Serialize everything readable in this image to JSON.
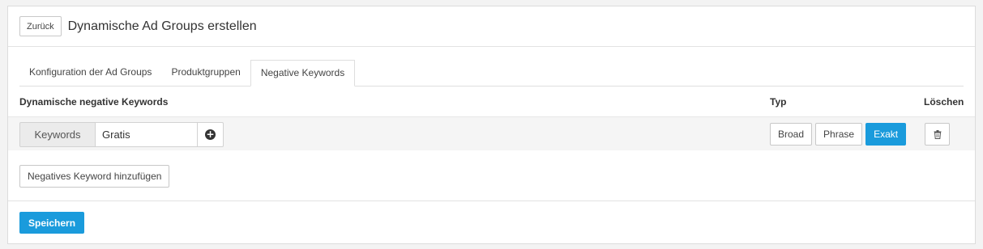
{
  "header": {
    "back_label": "Zurück",
    "title": "Dynamische Ad Groups erstellen"
  },
  "tabs": [
    {
      "label": "Konfiguration der Ad Groups",
      "active": false
    },
    {
      "label": "Produktgruppen",
      "active": false
    },
    {
      "label": "Negative Keywords",
      "active": true
    }
  ],
  "table": {
    "col_keywords": "Dynamische negative Keywords",
    "col_type": "Typ",
    "col_delete": "Löschen",
    "rows": [
      {
        "addon_label": "Keywords",
        "keyword_value": "Gratis",
        "add_icon": "plus-circle-icon",
        "type_options": [
          "Broad",
          "Phrase",
          "Exakt"
        ],
        "selected_type": "Exakt",
        "delete_icon": "trash-icon"
      }
    ]
  },
  "add_keyword_label": "Negatives Keyword hinzufügen",
  "save_label": "Speichern",
  "colors": {
    "accent": "#1a9bdc"
  }
}
